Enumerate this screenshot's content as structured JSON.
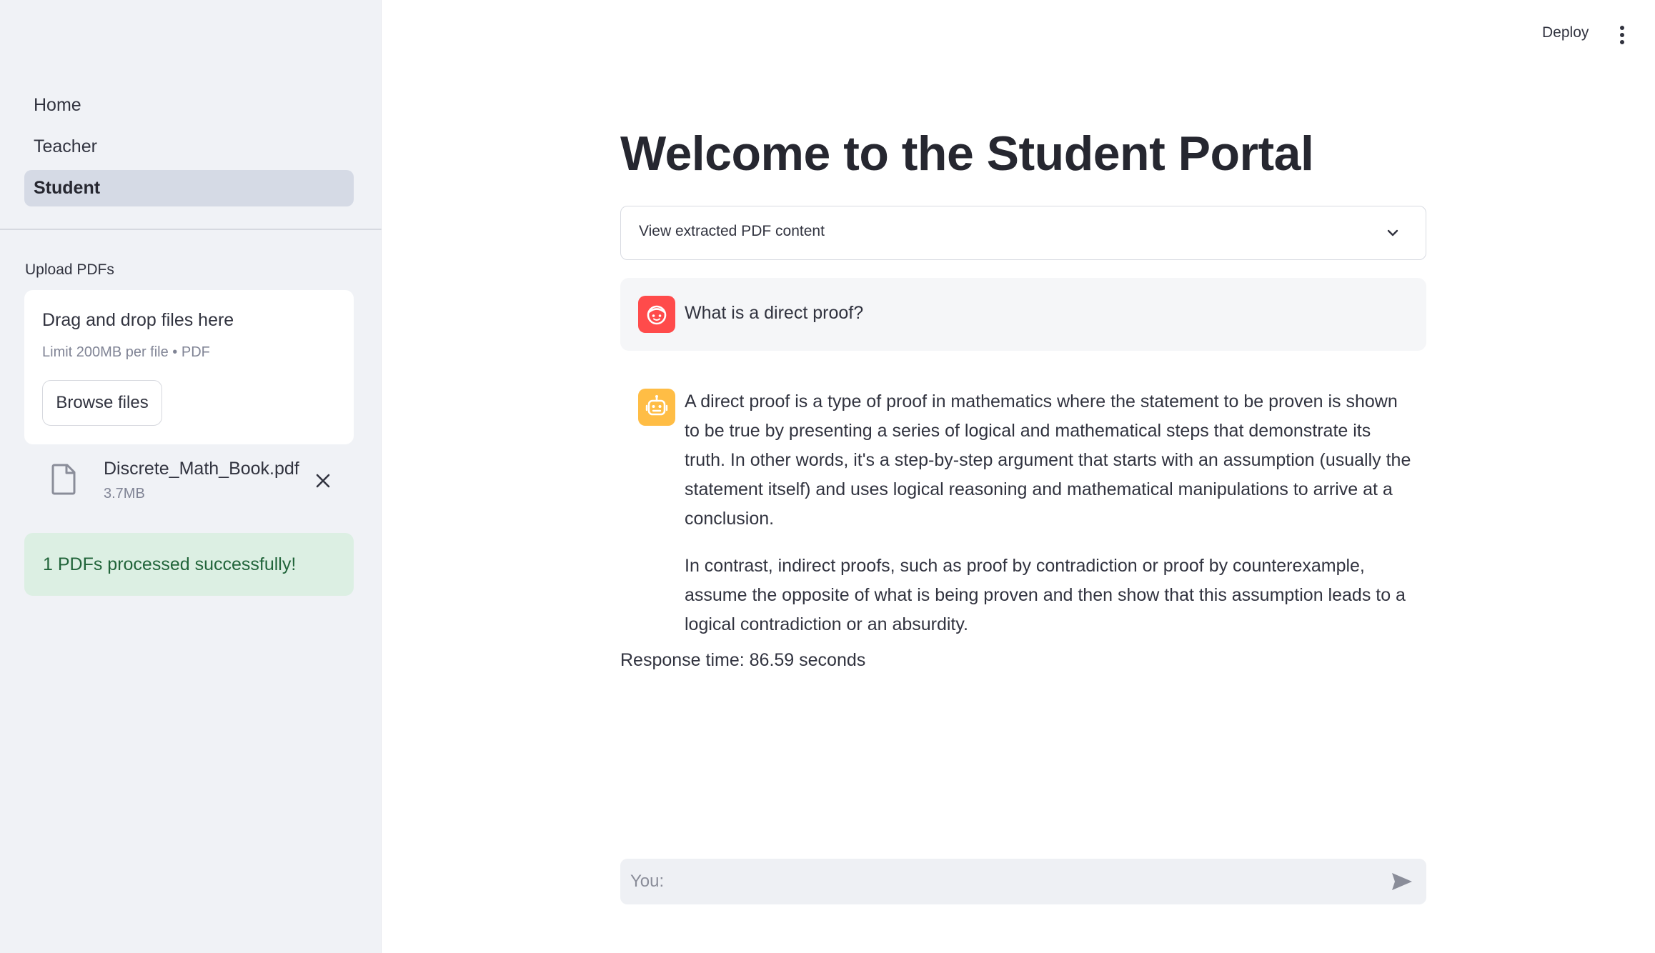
{
  "sidebar": {
    "nav": [
      {
        "label": "Home",
        "active": false
      },
      {
        "label": "Teacher",
        "active": false
      },
      {
        "label": "Student",
        "active": true
      }
    ],
    "upload_label": "Upload PDFs",
    "dropzone": {
      "title": "Drag and drop files here",
      "limit": "Limit 200MB per file • PDF",
      "browse_label": "Browse files"
    },
    "file": {
      "name": "Discrete_Math_Book.pdf",
      "size": "3.7MB"
    },
    "success_message": "1 PDFs processed successfully!"
  },
  "header": {
    "deploy_label": "Deploy"
  },
  "main": {
    "title": "Welcome to the Student Portal",
    "expander_label": "View extracted PDF content",
    "user_message": "What is a direct proof?",
    "assistant_paragraphs": [
      "A direct proof is a type of proof in mathematics where the statement to be proven is shown to be true by presenting a series of logical and mathematical steps that demonstrate its truth. In other words, it's a step-by-step argument that starts with an assumption (usually the statement itself) and uses logical reasoning and mathematical manipulations to arrive at a conclusion.",
      "In contrast, indirect proofs, such as proof by contradiction or proof by counterexample, assume the opposite of what is being proven and then show that this assumption leads to a logical contradiction or an absurdity."
    ],
    "response_time": "Response time: 86.59 seconds",
    "chat_placeholder": "You:"
  },
  "icons": {
    "user_avatar": "user-face-icon",
    "assistant_avatar": "robot-icon",
    "file": "file-icon",
    "remove": "close-icon",
    "expander": "chevron-down-icon",
    "menu": "vertical-dots-icon",
    "send": "send-icon"
  },
  "colors": {
    "sidebar_bg": "#f0f2f6",
    "nav_active_bg": "#d5dae5",
    "user_avatar": "#ff4b4b",
    "assistant_avatar": "#ffbd45",
    "success_bg": "#dcefe3",
    "success_text": "#21643a"
  }
}
